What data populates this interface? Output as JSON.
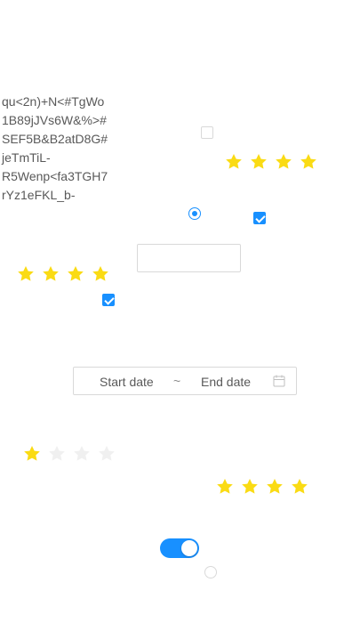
{
  "text_block": "qu<2n)+N<#TgWo\n1B89jJVs6W&%>#\nSEF5B&B2atD8G#\njeTmTiL-\nR5Wenp<fa3TGH7\nrYz1eFKL_b-",
  "checkboxes": [
    {
      "checked": false
    },
    {
      "checked": true
    },
    {
      "checked": true
    }
  ],
  "radios": [
    {
      "checked": true
    },
    {
      "checked": false
    }
  ],
  "ratings": [
    {
      "value": 4,
      "count": 4
    },
    {
      "value": 4,
      "count": 4
    },
    {
      "value": 1,
      "count": 4
    },
    {
      "value": 4,
      "count": 4
    }
  ],
  "text_input": {
    "value": "",
    "placeholder": ""
  },
  "date_range": {
    "start_placeholder": "Start date",
    "separator": "~",
    "end_placeholder": "End date",
    "icon": "calendar-icon"
  },
  "switch": {
    "on": true
  },
  "colors": {
    "primary": "#1890ff",
    "star": "#fadb14",
    "star_empty": "#f0f0f0",
    "border": "#d9d9d9"
  }
}
